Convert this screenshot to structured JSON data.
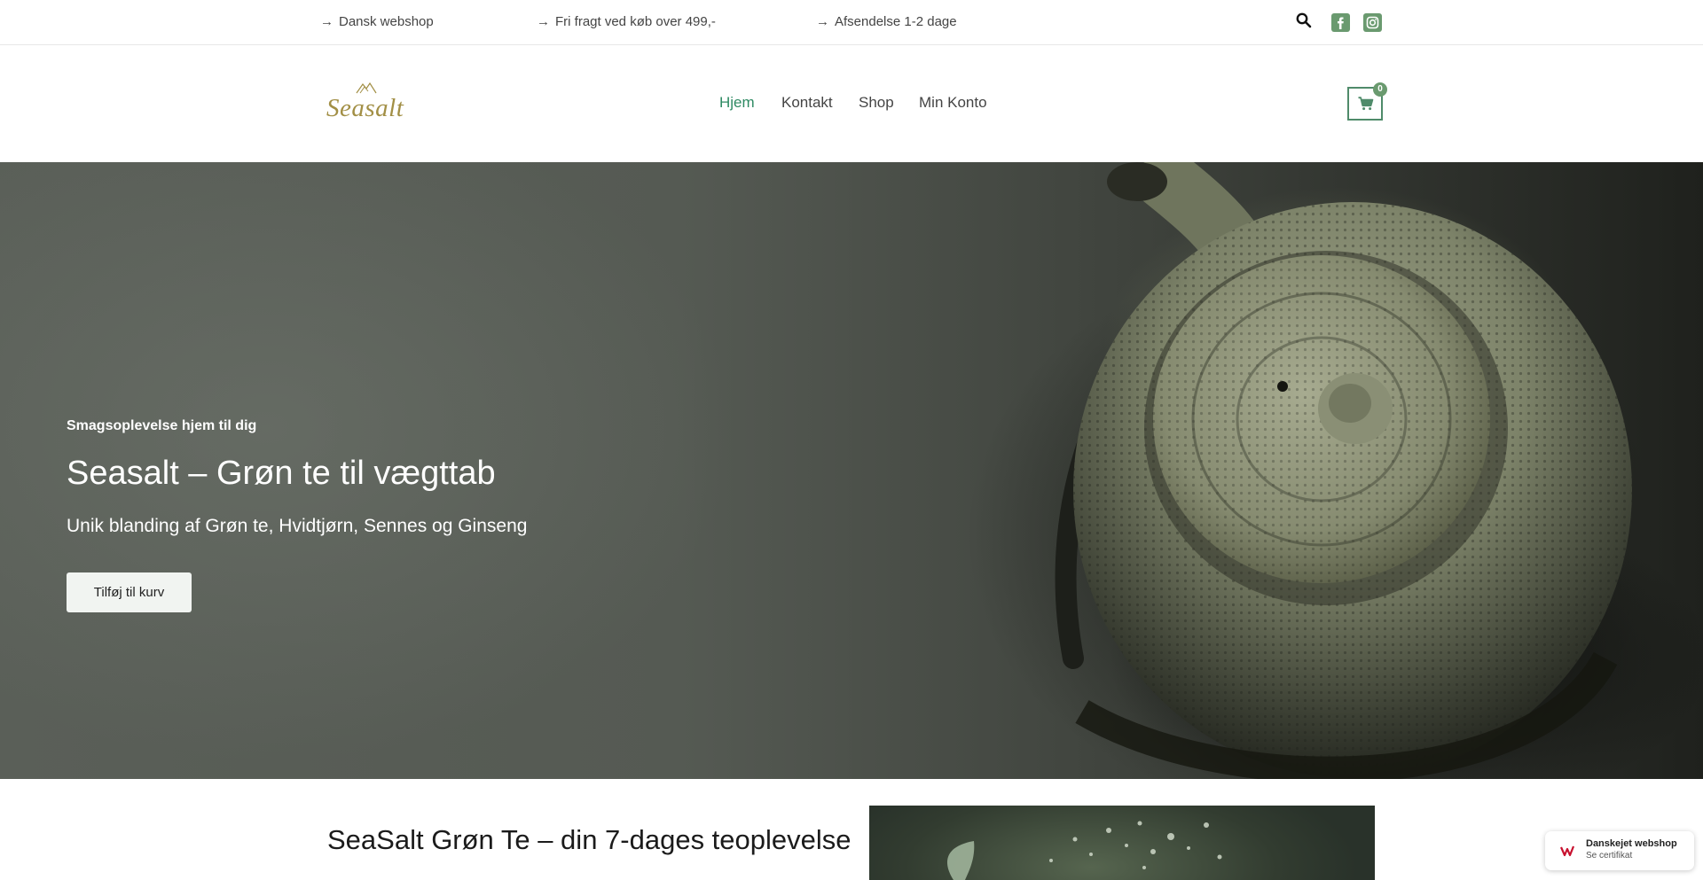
{
  "topbar": {
    "usps": [
      {
        "arrow": "→",
        "text": "Dansk webshop"
      },
      {
        "arrow": "→",
        "text": "Fri fragt ved køb over 499,-"
      },
      {
        "arrow": "→",
        "text": "Afsendelse 1-2 dage"
      }
    ],
    "icons": {
      "search": "search-icon",
      "facebook": "facebook-icon",
      "instagram": "instagram-icon"
    }
  },
  "header": {
    "logo_text": "Seasalt",
    "nav": [
      {
        "label": "Hjem",
        "active": true
      },
      {
        "label": "Kontakt",
        "active": false
      },
      {
        "label": "Shop",
        "active": false
      },
      {
        "label": "Min Konto",
        "active": false
      }
    ],
    "cart": {
      "icon": "cart-icon",
      "count": "0"
    }
  },
  "hero": {
    "eyebrow": "Smagsoplevelse hjem til dig",
    "title": "Seasalt – Grøn te til vægttab",
    "subtitle": "Unik blanding af Grøn te, Hvidtjørn, Sennes og Ginseng",
    "cta_label": "Tilføj til kurv"
  },
  "section": {
    "title": "SeaSalt Grøn Te – din 7-dages teoplevelse"
  },
  "trust_badge": {
    "name": "Danskejet webshop",
    "link": "Se certifikat"
  },
  "colors": {
    "accent": "#2e8a63",
    "social": "#6a9a6f",
    "logo": "#a28f45",
    "cart_border": "#4f8b6a"
  }
}
